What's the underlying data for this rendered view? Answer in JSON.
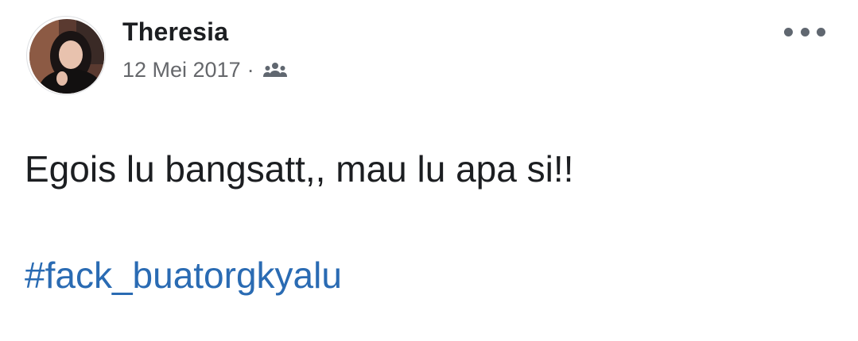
{
  "post": {
    "author": "Theresia",
    "date": "12 Mei 2017",
    "separator": "·",
    "audience_icon": "friends-icon",
    "body_text": "Egois lu bangsatt,, mau lu apa si!!",
    "hashtag": "#fack_buatorgkyalu",
    "more_icon": "more-options-icon"
  },
  "colors": {
    "name": "#1c1e21",
    "meta": "#65676b",
    "hashtag": "#2a6bb3",
    "icon": "#606770"
  }
}
